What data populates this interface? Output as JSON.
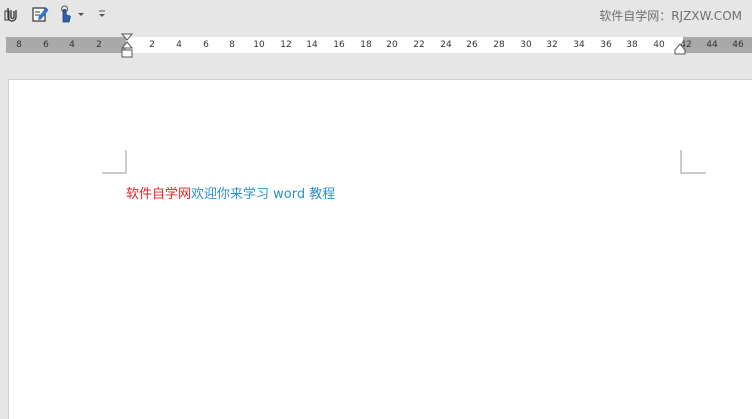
{
  "toolbar": {
    "watermark": "软件自学网：RJZXW.COM"
  },
  "ruler": {
    "ticks": [
      "8",
      "6",
      "4",
      "2",
      "2",
      "4",
      "6",
      "8",
      "10",
      "12",
      "14",
      "16",
      "18",
      "20",
      "22",
      "24",
      "26",
      "28",
      "30",
      "32",
      "34",
      "36",
      "38",
      "40",
      "42",
      "44",
      "46"
    ]
  },
  "document": {
    "text_red": "软件自学网",
    "text_blue": "欢迎你来学习 word 教程"
  },
  "colors": {
    "red_text": "#e52222",
    "blue_text": "#2b8fd6"
  }
}
